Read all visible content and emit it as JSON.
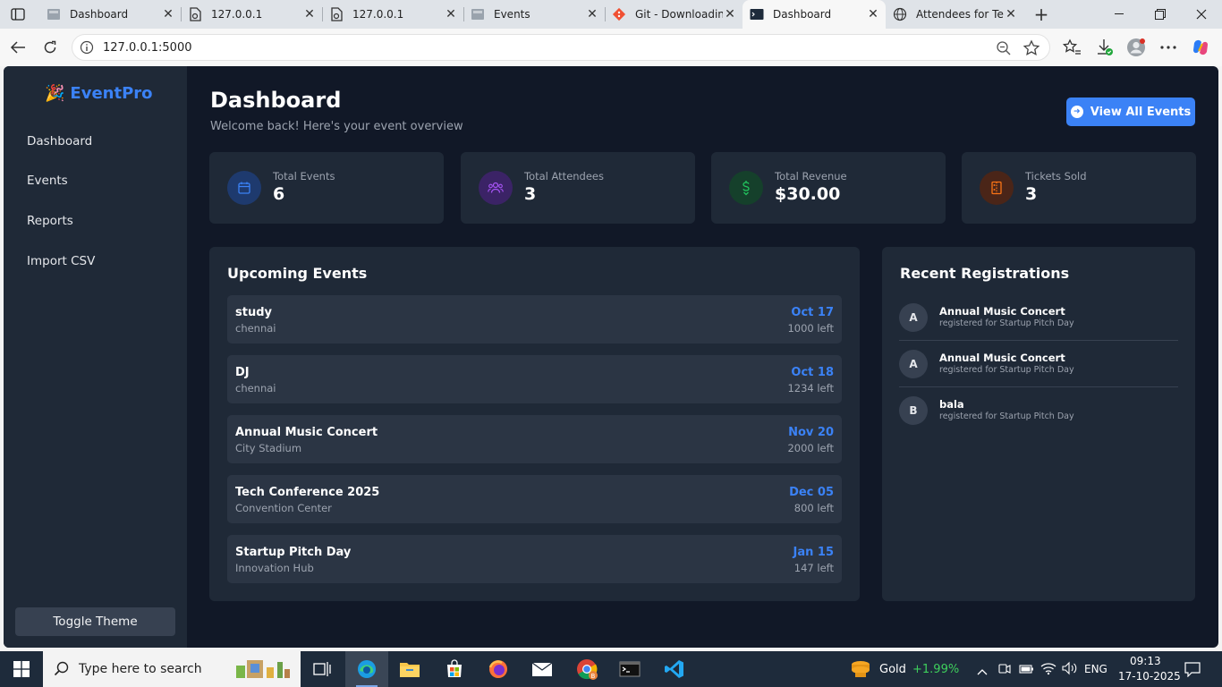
{
  "browser": {
    "tabs": [
      {
        "title": "Dashboard",
        "icon": "page-icon"
      },
      {
        "title": "127.0.0.1",
        "icon": "file-icon"
      },
      {
        "title": "127.0.0.1",
        "icon": "file-icon"
      },
      {
        "title": "Events",
        "icon": "page-icon"
      },
      {
        "title": "Git - Downloading",
        "icon": "git-icon"
      },
      {
        "title": "Dashboard",
        "icon": "terminal-icon"
      },
      {
        "title": "Attendees for Tech",
        "icon": "globe-icon"
      }
    ],
    "close_glyph": "✕",
    "new_tab_glyph": "+",
    "url": "127.0.0.1:5000"
  },
  "sidebar": {
    "brand": "EventPro",
    "brand_emoji": "🎉",
    "items": [
      {
        "label": "Dashboard"
      },
      {
        "label": "Events"
      },
      {
        "label": "Reports"
      },
      {
        "label": "Import CSV"
      }
    ],
    "toggle_label": "Toggle Theme"
  },
  "header": {
    "title": "Dashboard",
    "subtitle": "Welcome back! Here's your event overview",
    "view_all_label": "View All Events"
  },
  "stats": [
    {
      "label": "Total Events",
      "value": "6",
      "icon": "calendar-icon",
      "color": "#3b82f6"
    },
    {
      "label": "Total Attendees",
      "value": "3",
      "icon": "users-icon",
      "color": "#a855f7"
    },
    {
      "label": "Total Revenue",
      "value": "$30.00",
      "icon": "dollar-icon",
      "color": "#22c55e"
    },
    {
      "label": "Tickets Sold",
      "value": "3",
      "icon": "ticket-icon",
      "color": "#f97316"
    }
  ],
  "upcoming": {
    "title": "Upcoming Events",
    "events": [
      {
        "name": "study",
        "location": "chennai",
        "date": "Oct 17",
        "left": "1000 left"
      },
      {
        "name": "DJ",
        "location": "chennai",
        "date": "Oct 18",
        "left": "1234 left"
      },
      {
        "name": "Annual Music Concert",
        "location": "City Stadium",
        "date": "Nov 20",
        "left": "2000 left"
      },
      {
        "name": "Tech Conference 2025",
        "location": "Convention Center",
        "date": "Dec 05",
        "left": "800 left"
      },
      {
        "name": "Startup Pitch Day",
        "location": "Innovation Hub",
        "date": "Jan 15",
        "left": "147 left"
      }
    ]
  },
  "recent": {
    "title": "Recent Registrations",
    "items": [
      {
        "initial": "A",
        "name": "Annual Music Concert",
        "desc": "registered for Startup Pitch Day"
      },
      {
        "initial": "A",
        "name": "Annual Music Concert",
        "desc": "registered for Startup Pitch Day"
      },
      {
        "initial": "B",
        "name": "bala",
        "desc": "registered for Startup Pitch Day"
      }
    ]
  },
  "taskbar": {
    "search_placeholder": "Type here to search",
    "weather_label": "Gold",
    "weather_change": "+1.99%",
    "lang": "ENG",
    "time": "09:13",
    "date": "17-10-2025"
  }
}
